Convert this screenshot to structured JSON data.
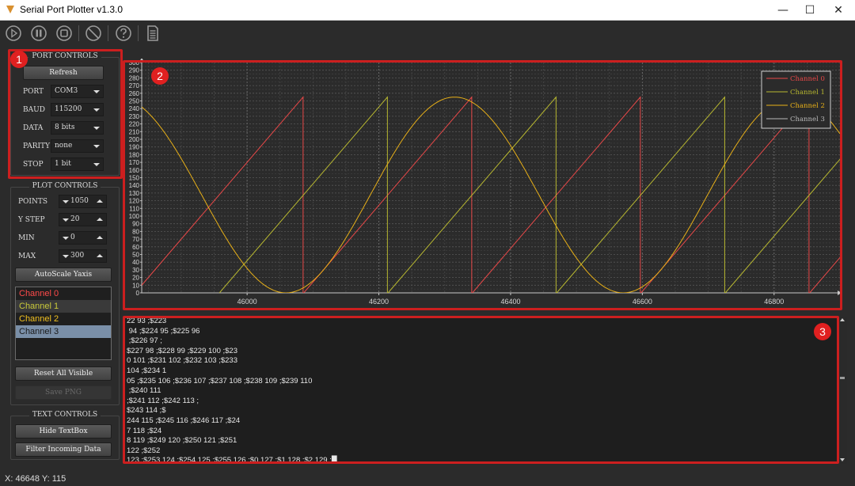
{
  "window": {
    "title": "Serial Port Plotter v1.3.0",
    "minimize": "—",
    "maximize": "☐",
    "close": "✕"
  },
  "toolbar": {
    "icons": [
      "play-icon",
      "pause-icon",
      "stop-icon",
      "clear-icon",
      "help-icon",
      "document-icon"
    ]
  },
  "annotations": {
    "colors": {
      "highlight": "#cc1f1f",
      "badge": "#e02020"
    },
    "badges": [
      "1",
      "2",
      "3"
    ]
  },
  "port_controls": {
    "title": "PORT CONTROLS",
    "refresh_label": "Refresh",
    "port_label": "PORT",
    "port_value": "COM3",
    "baud_label": "BAUD",
    "baud_value": "115200",
    "data_label": "DATA",
    "data_value": "8 bits",
    "parity_label": "PARITY",
    "parity_value": "none",
    "stop_label": "STOP",
    "stop_value": "1 bit"
  },
  "plot_controls": {
    "title": "PLOT CONTROLS",
    "points_label": "POINTS",
    "points_value": "1050",
    "ystep_label": "Y STEP",
    "ystep_value": "20",
    "min_label": "MIN",
    "min_value": "0",
    "max_label": "MAX",
    "max_value": "300",
    "autoscale_label": "AutoScale Yaxis",
    "channels": [
      {
        "label": "Channel 0",
        "color": "#ff4a4a"
      },
      {
        "label": "Channel 1",
        "color": "#c9c93a"
      },
      {
        "label": "Channel 2",
        "color": "#f0c020"
      },
      {
        "label": "Channel 3",
        "color": "#1a1a1a"
      }
    ],
    "reset_label": "Reset All Visible",
    "save_label": "Save PNG"
  },
  "text_controls": {
    "title": "TEXT CONTROLS",
    "hide_label": "Hide TextBox",
    "filter_label": "Filter Incoming Data"
  },
  "console": {
    "lines": [
      "22 93 ;$223",
      " 94 ;$224 95 ;$225 96",
      " ;$226 97 ;",
      "$227 98 ;$228 99 ;$229 100 ;$23",
      "0 101 ;$231 102 ;$232 103 ;$233",
      "104 ;$234 1",
      "05 ;$235 106 ;$236 107 ;$237 108 ;$238 109 ;$239 110",
      " ;$240 111",
      ";$241 112 ;$242 113 ;",
      "$243 114 ;$",
      "244 115 ;$245 116 ;$246 117 ;$24",
      "7 118 ;$24",
      "8 119 ;$249 120 ;$250 121 ;$251",
      "122 ;$252",
      "123 ;$253 124 ;$254 125 ;$255 126 ;$0 127 ;$1 128 ;$2 129 ;█",
      "$1 128"
    ]
  },
  "status": {
    "text": "X: 46648 Y: 115"
  },
  "chart_data": {
    "type": "line",
    "xlim": [
      45840,
      46900
    ],
    "ylim": [
      0,
      300
    ],
    "x_ticks": [
      46000,
      46200,
      46400,
      46600,
      46800
    ],
    "y_ticks": [
      0,
      10,
      20,
      30,
      40,
      50,
      60,
      70,
      80,
      90,
      100,
      110,
      120,
      130,
      140,
      150,
      160,
      170,
      180,
      190,
      200,
      210,
      220,
      230,
      240,
      250,
      260,
      270,
      280,
      290,
      300
    ],
    "grid": true,
    "legend_position": "top-right",
    "background": "#2b2b2b",
    "series": [
      {
        "name": "Channel 0",
        "color": "#e84848",
        "shape": "sawtooth",
        "period": 256,
        "amplitude": 255,
        "zero_at": [
          45830,
          46086,
          46342,
          46598,
          46854
        ]
      },
      {
        "name": "Channel 1",
        "color": "#b8b830",
        "shape": "sawtooth",
        "period": 256,
        "amplitude": 255,
        "zero_at": [
          45958,
          46214,
          46470,
          46726
        ]
      },
      {
        "name": "Channel 2",
        "color": "#e8b018",
        "shape": "sine",
        "period": 512,
        "amplitude": 127.5,
        "offset": 127.5,
        "peak_at": 46315
      },
      {
        "name": "Channel 3",
        "color": "#b8b8b8",
        "shape": "hidden"
      }
    ]
  }
}
